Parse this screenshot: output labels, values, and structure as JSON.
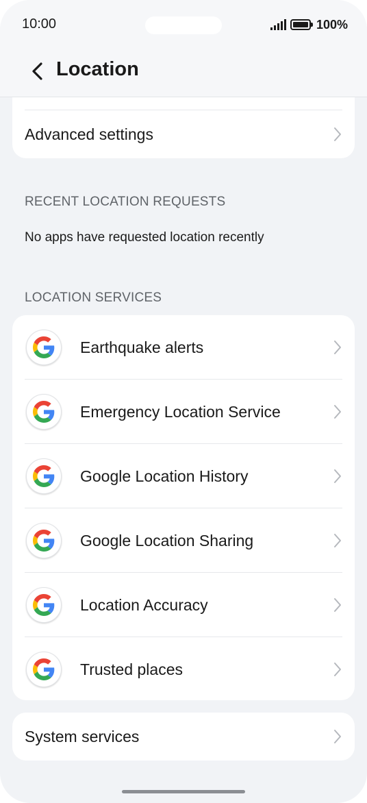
{
  "status_bar": {
    "time": "10:00",
    "battery": "100%"
  },
  "header": {
    "back_icon": "chevron-left-icon",
    "title": "Location"
  },
  "top_card": {
    "advanced_settings": "Advanced settings"
  },
  "recent_requests": {
    "header": "RECENT LOCATION REQUESTS",
    "note": "No apps have requested location recently"
  },
  "location_services": {
    "header": "LOCATION SERVICES",
    "items": [
      {
        "label": "Earthquake alerts",
        "icon": "google-icon"
      },
      {
        "label": "Emergency Location Service",
        "icon": "google-icon"
      },
      {
        "label": "Google Location History",
        "icon": "google-icon"
      },
      {
        "label": "Google Location Sharing",
        "icon": "google-icon"
      },
      {
        "label": "Location Accuracy",
        "icon": "google-icon"
      },
      {
        "label": "Trusted places",
        "icon": "google-icon"
      }
    ]
  },
  "system_services": {
    "label": "System services"
  },
  "colors": {
    "background": "#f1f3f6",
    "card": "#ffffff",
    "section_header": "#5f6368",
    "google_blue": "#4285F4",
    "google_red": "#EA4335",
    "google_yellow": "#FBBC05",
    "google_green": "#34A853"
  }
}
